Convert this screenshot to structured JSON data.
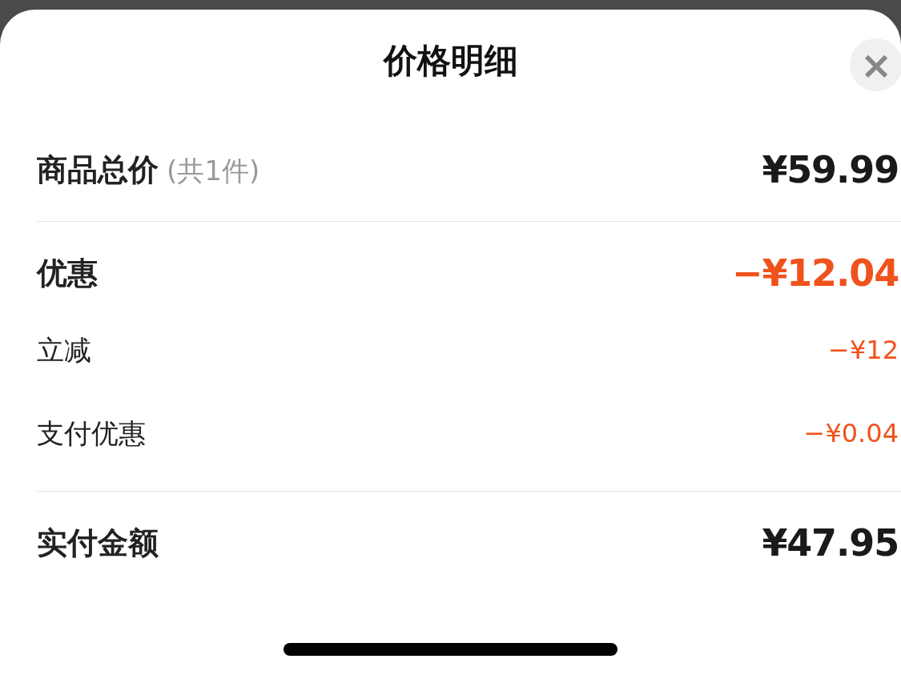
{
  "sheet": {
    "title": "价格明细",
    "close_icon": "×"
  },
  "sections": [
    [
      {
        "kind": "main",
        "label": "商品总价",
        "note": "(共1件)",
        "amount": "¥59.99",
        "discount": false
      }
    ],
    [
      {
        "kind": "main",
        "label": "优惠",
        "amount": "−¥12.04",
        "discount": true
      },
      {
        "kind": "sub",
        "label": "立减",
        "amount": "−¥12",
        "discount": true
      },
      {
        "kind": "sub",
        "label": "支付优惠",
        "amount": "−¥0.04",
        "discount": true
      }
    ],
    [
      {
        "kind": "main",
        "label": "实付金额",
        "amount": "¥47.95",
        "discount": false
      }
    ]
  ]
}
